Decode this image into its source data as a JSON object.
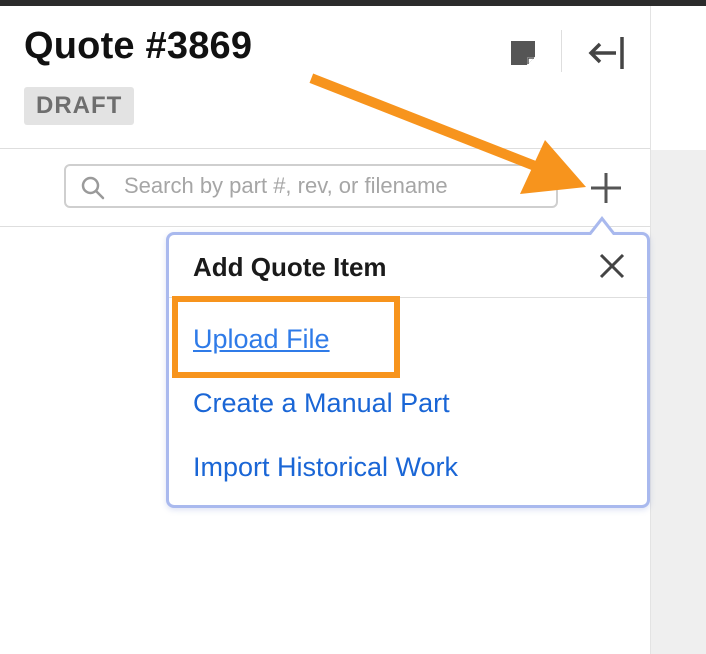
{
  "header": {
    "title": "Quote #3869",
    "status": "DRAFT"
  },
  "search": {
    "placeholder": "Search by part #, rev, or filename",
    "value": ""
  },
  "popover": {
    "title": "Add Quote Item",
    "items": [
      {
        "label": "Upload File"
      },
      {
        "label": "Create a Manual Part"
      },
      {
        "label": "Import Historical Work"
      }
    ]
  },
  "colors": {
    "link": "#1a66d6",
    "link_active": "#2f7be8",
    "annotation": "#f7941d",
    "popover_border": "#a9b9ee",
    "badge_bg": "#e3e3e3"
  },
  "icons": {
    "note": "sticky-note-icon",
    "collapse": "collapse-panel-icon",
    "search": "search-icon",
    "add": "plus-icon",
    "close": "close-icon"
  }
}
